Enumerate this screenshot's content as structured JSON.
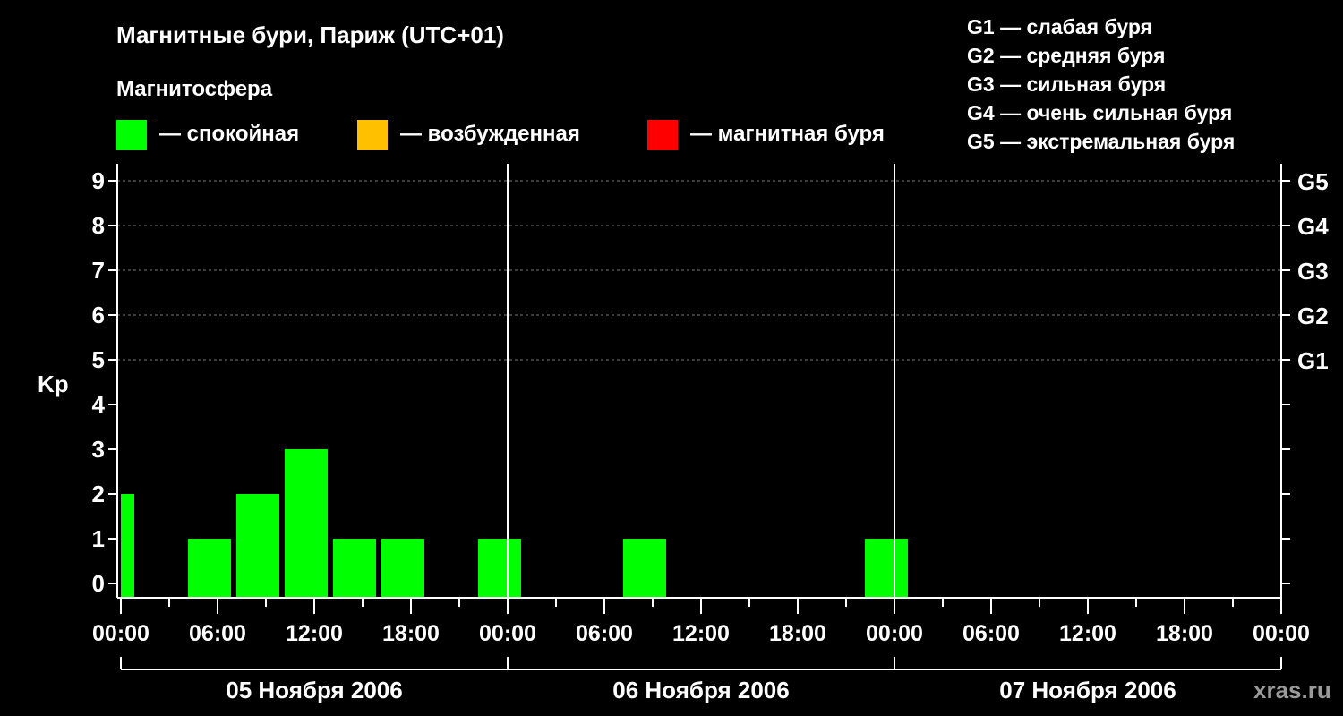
{
  "header": {
    "title": "Магнитные бури, Париж (UTC+01)",
    "subtitle": "Магнитосфера",
    "legend": [
      {
        "label": "— спокойная",
        "color": "#00ff00"
      },
      {
        "label": "— возбужденная",
        "color": "#ffc000"
      },
      {
        "label": "— магнитная буря",
        "color": "#ff0000"
      }
    ],
    "g_scale": [
      "G1 — слабая буря",
      "G2 — средняя буря",
      "G3 — сильная буря",
      "G4 — очень сильная буря",
      "G5 — экстремальная буря"
    ]
  },
  "watermark": "xras.ru",
  "chart_data": {
    "type": "bar",
    "title": "Магнитные бури, Париж (UTC+01)",
    "ylabel": "Kp",
    "ylim": [
      0,
      9
    ],
    "yticks": [
      "0",
      "1",
      "2",
      "3",
      "4",
      "5",
      "6",
      "7",
      "8",
      "9"
    ],
    "right_ticks": [
      {
        "kp": 5,
        "label": "G1"
      },
      {
        "kp": 6,
        "label": "G2"
      },
      {
        "kp": 7,
        "label": "G3"
      },
      {
        "kp": 8,
        "label": "G4"
      },
      {
        "kp": 9,
        "label": "G5"
      }
    ],
    "xlim_hours": [
      0,
      72
    ],
    "xticks": [
      "00:00",
      "06:00",
      "12:00",
      "18:00",
      "00:00",
      "06:00",
      "12:00",
      "18:00",
      "00:00",
      "06:00",
      "12:00",
      "18:00",
      "00:00"
    ],
    "days": [
      "05 Ноября 2006",
      "06 Ноября 2006",
      "07 Ноября 2006"
    ],
    "grid_kp": [
      5,
      6,
      7,
      8,
      9
    ],
    "bar_hours": 3,
    "bars": [
      {
        "start_hour": -2,
        "kp": 2
      },
      {
        "start_hour": 1,
        "kp": 0
      },
      {
        "start_hour": 4,
        "kp": 1
      },
      {
        "start_hour": 7,
        "kp": 2
      },
      {
        "start_hour": 10,
        "kp": 3
      },
      {
        "start_hour": 13,
        "kp": 1
      },
      {
        "start_hour": 16,
        "kp": 1
      },
      {
        "start_hour": 19,
        "kp": 0
      },
      {
        "start_hour": 22,
        "kp": 1
      },
      {
        "start_hour": 25,
        "kp": 0
      },
      {
        "start_hour": 28,
        "kp": 0
      },
      {
        "start_hour": 31,
        "kp": 1
      },
      {
        "start_hour": 34,
        "kp": 0
      },
      {
        "start_hour": 37,
        "kp": 0
      },
      {
        "start_hour": 40,
        "kp": 0
      },
      {
        "start_hour": 43,
        "kp": 0
      },
      {
        "start_hour": 46,
        "kp": 1
      }
    ],
    "bar_color": "#00ff00"
  }
}
